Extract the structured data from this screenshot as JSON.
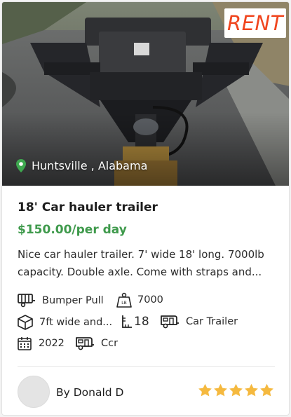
{
  "listing": {
    "badge": "RENT",
    "location": "Huntsville , Alabama",
    "title": "18' Car hauler trailer",
    "price": "$150.00/per day",
    "description": "Nice car hauler trailer. 7' wide 18' long. 7000lb capacity. Double axle. Come with straps and...",
    "specs": {
      "hitch": "Bumper Pull",
      "capacity": "7000",
      "dimensions": "7ft wide and...",
      "length": "18",
      "category": "Car Trailer",
      "year": "2022",
      "model": "Ccr"
    },
    "owner": "By Donald D",
    "rating": 5
  },
  "icons": {
    "location": "map-pin-icon",
    "hitch": "trailer-hitch-icon",
    "capacity": "weight-icon",
    "dimensions": "box-icon",
    "length": "length-icon",
    "category": "camper-icon",
    "year": "calendar-icon",
    "model": "trailer-icon",
    "rating": "star-icon"
  },
  "colors": {
    "accent": "#f0461f",
    "price": "#3f9a4c",
    "pin": "#3ea84f",
    "star": "#f5b93f"
  }
}
